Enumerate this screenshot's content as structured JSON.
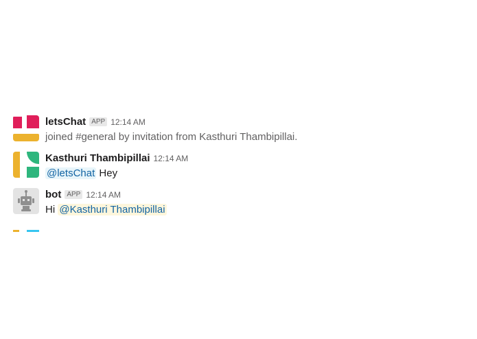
{
  "messages": [
    {
      "sender": "letsChat",
      "badge": "APP",
      "time": "12:14 AM",
      "text": "joined #general by invitation from Kasthuri Thambipillai.",
      "avatar_icon": "letschat-logo-icon"
    },
    {
      "sender": "Kasthuri Thambipillai",
      "time": "12:14 AM",
      "mention": "@letsChat",
      "text_after": " Hey",
      "avatar_icon": "user-avatar-icon"
    },
    {
      "sender": "bot",
      "badge": "APP",
      "time": "12:14 AM",
      "text_before": "Hi ",
      "mention": "@Kasthuri Thambipillai",
      "avatar_icon": "bot-robot-icon"
    }
  ],
  "colors": {
    "red": "#e01e5a",
    "yellow": "#ecb22e",
    "green": "#2eb67d",
    "blue": "#36c5f0",
    "mention_bg": "#e8f5fa",
    "self_mention_bg": "#fef6dc",
    "link": "#1264a3"
  }
}
